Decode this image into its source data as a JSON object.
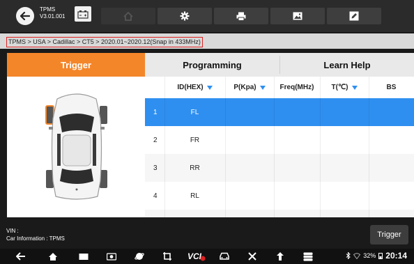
{
  "app": {
    "name": "TPMS",
    "version": "V3.01.001"
  },
  "toolbar": {
    "buttons": [
      {
        "name": "home",
        "icon": "home-icon"
      },
      {
        "name": "settings",
        "icon": "gear-icon"
      },
      {
        "name": "print",
        "icon": "printer-icon"
      },
      {
        "name": "screenshot",
        "icon": "image-icon"
      },
      {
        "name": "edit",
        "icon": "edit-icon"
      }
    ]
  },
  "breadcrumb": "TPMS > USA > Cadillac > CT5 > 2020.01~2020.12(Snap in 433MHz)",
  "tabs": [
    {
      "label": "Trigger",
      "active": true
    },
    {
      "label": "Programming",
      "active": false
    },
    {
      "label": "Learn Help",
      "active": false
    }
  ],
  "table": {
    "headers": [
      "",
      "ID(HEX)",
      "P(Kpa)",
      "Freq(MHz)",
      "T(℃)",
      "BS"
    ],
    "rows": [
      {
        "no": "1",
        "id": "FL",
        "p": "",
        "freq": "",
        "t": "",
        "bs": "",
        "selected": true
      },
      {
        "no": "2",
        "id": "FR",
        "p": "",
        "freq": "",
        "t": "",
        "bs": "",
        "selected": false
      },
      {
        "no": "3",
        "id": "RR",
        "p": "",
        "freq": "",
        "t": "",
        "bs": "",
        "selected": false
      },
      {
        "no": "4",
        "id": "RL",
        "p": "",
        "freq": "",
        "t": "",
        "bs": "",
        "selected": false
      }
    ]
  },
  "footer": {
    "vin": "VIN :",
    "car_info": "Car Information : TPMS",
    "trigger_label": "Trigger"
  },
  "navbar": {
    "vci_label": "VCI",
    "battery": "32%",
    "time": "20:14"
  },
  "colors": {
    "accent": "#f4862a",
    "selected_row": "#2e8ff0",
    "highlight_box": "#e02020"
  }
}
